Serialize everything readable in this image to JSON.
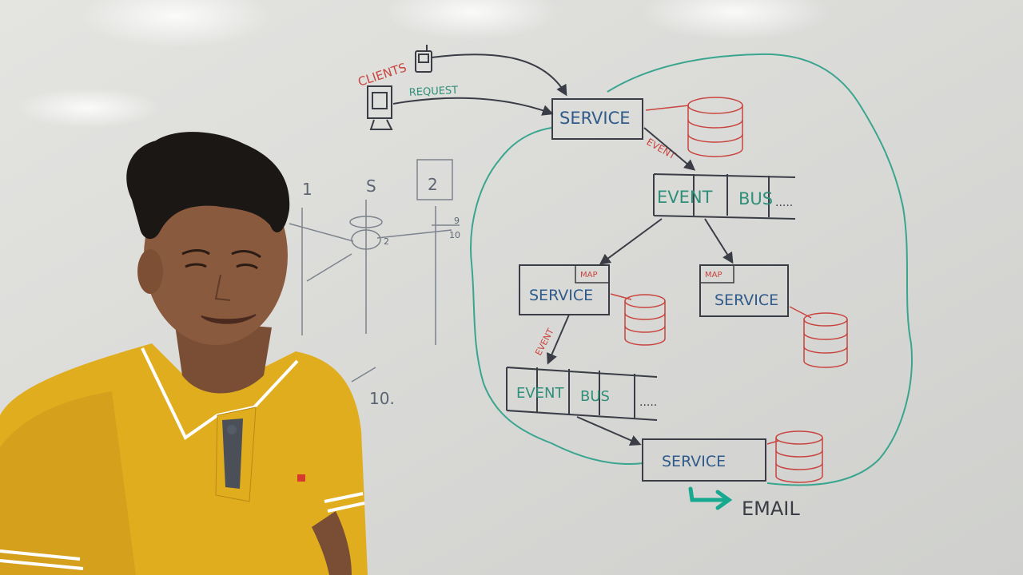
{
  "colors": {
    "board": "#dcdcd8",
    "marker_black": "#3a3d45",
    "marker_blue": "#2f5a8a",
    "marker_green": "#2f8f7a",
    "marker_red": "#c9443f",
    "shirt": "#e0ad1e",
    "skin": "#8a5a3e",
    "hair": "#1b1714",
    "arrow_teal": "#16a98f"
  },
  "whiteboard": {
    "clients_label": "CLIENTS",
    "request_label": "REQUEST",
    "service_label": "SERVICE",
    "event_label": "EVENT",
    "bus_label": "BUS",
    "bus_trail": ".....",
    "map_label": "MAP",
    "email_label": "EMAIL",
    "seq_1": "1",
    "seq_s": "S",
    "seq_2": "2",
    "seq_9": "9",
    "seq_10_small": "10",
    "seq_2_small": "2",
    "seq_10": "10."
  },
  "icons": [
    "phone-icon",
    "monitor-icon",
    "database-icon",
    "arrow-right-icon"
  ]
}
